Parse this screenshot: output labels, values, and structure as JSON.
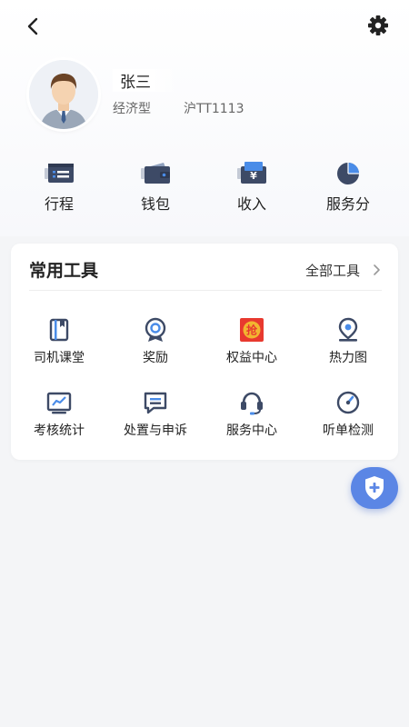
{
  "header": {
    "back_icon": "chevron-left-icon",
    "settings_icon": "gear-icon"
  },
  "profile": {
    "name": "张三",
    "car_type": "经济型",
    "plate": "沪TT1113",
    "avatar_icon": "driver-avatar"
  },
  "quick_actions": [
    {
      "label": "行程",
      "icon": "trip-card-icon"
    },
    {
      "label": "钱包",
      "icon": "wallet-icon"
    },
    {
      "label": "收入",
      "icon": "income-yen-icon"
    },
    {
      "label": "服务分",
      "icon": "pie-score-icon"
    }
  ],
  "tools": {
    "title": "常用工具",
    "all_label": "全部工具",
    "items": [
      {
        "label": "司机课堂",
        "icon": "book-icon"
      },
      {
        "label": "奖励",
        "icon": "medal-icon"
      },
      {
        "label": "权益中心",
        "icon": "grab-badge-icon"
      },
      {
        "label": "热力图",
        "icon": "location-pin-icon"
      },
      {
        "label": "考核统计",
        "icon": "chart-board-icon"
      },
      {
        "label": "处置与申诉",
        "icon": "message-icon"
      },
      {
        "label": "服务中心",
        "icon": "headset-icon"
      },
      {
        "label": "听单检测",
        "icon": "gauge-icon"
      }
    ]
  },
  "fab": {
    "icon": "shield-plus-icon"
  },
  "colors": {
    "icon_dark": "#3d4a66",
    "accent_blue": "#4a8ce8",
    "grab_red": "#e8392f",
    "grab_gold": "#f2b530",
    "fab_blue": "#5b86e5",
    "background": "#f4f5f7"
  }
}
